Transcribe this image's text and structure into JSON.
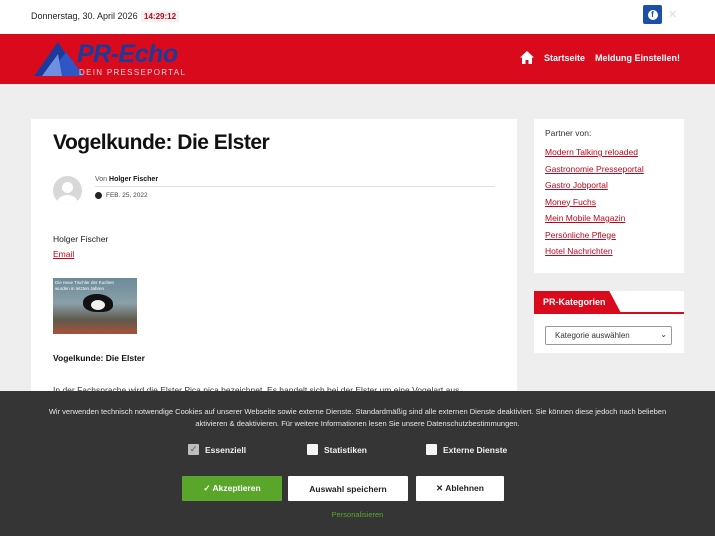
{
  "topbar": {
    "date": "Donnerstag, 30. April 2026",
    "time": "14:29:12",
    "social": [
      {
        "icon": "facebook-icon"
      },
      {
        "icon": "x-twitter-icon"
      }
    ]
  },
  "header": {
    "logo_text": "PR-Echo",
    "logo_tagline": "DEIN PRESSEPORTAL",
    "nav": {
      "home_icon": "home-icon",
      "items": [
        "Startseite",
        "Meldung Einstellen!"
      ]
    },
    "brand_color": "#d80a1c"
  },
  "article": {
    "title": "Vogelkunde: Die Elster",
    "by_prefix": "Von",
    "author": "Holger Fischer",
    "date": "FEB. 25, 2022",
    "contact_name": "Holger Fischer",
    "contact_email": "Email",
    "image_caption": "Die neue Tischler der Kuchen wurden in letzten Jahren",
    "subheading": "Vogelkunde: Die Elster",
    "body_start": "In der Fachsprache wird die Elster Pica pica bezeichnet. Es handelt sich bei der Elster um eine Vogelart aus"
  },
  "sidebar": {
    "partner_title": "Partner von:",
    "partners": [
      "Modern Talking reloaded",
      "Gastronomie Presseportal",
      "Gastro Jobportal",
      "Money Fuchs",
      "Mein Mobile Magazin",
      "Persönliche Pflege",
      "Hotel Nachrichten"
    ],
    "categories_title": "PR-Kategorien",
    "categories_select": "Kategorie auswählen"
  },
  "cookie": {
    "message": "Wir verwenden technisch notwendige Cookies auf unserer Webseite sowie externe Dienste. Standardmäßig sind alle externen Dienste deaktiviert. Sie können diese jedoch nach belieben aktivieren & deaktivieren. Für weitere Informationen lesen Sie unsere Datenschutzbestimmungen.",
    "options": [
      {
        "label": "Essenziell",
        "checked": true
      },
      {
        "label": "Statistiken",
        "checked": false
      },
      {
        "label": "Externe Dienste",
        "checked": false
      }
    ],
    "accept_label": "✓ Akzeptieren",
    "save_label": "Auswahl speichern",
    "reject_label": "✕ Ablehnen",
    "personalize_label": "Personalisieren",
    "accept_color": "#5aa62b"
  }
}
